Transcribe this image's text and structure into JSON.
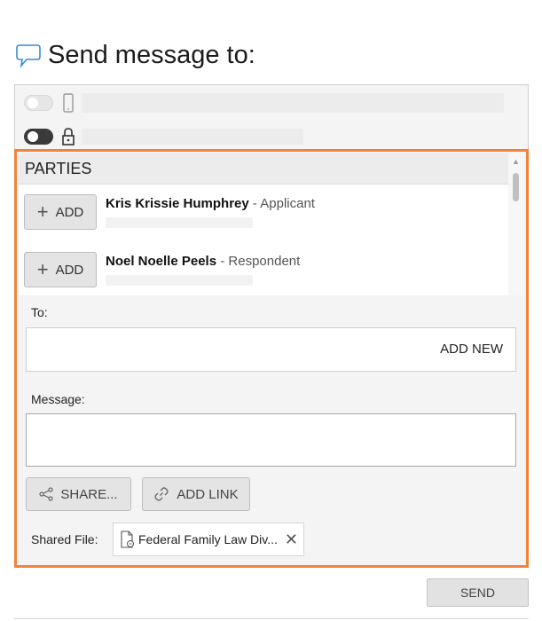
{
  "header": {
    "title": "Send message to:",
    "icon": "chat-bubble-icon"
  },
  "toggles": [
    {
      "state": "off",
      "icon": "mobile-phone-icon"
    },
    {
      "state": "on",
      "icon": "lock-icon"
    }
  ],
  "parties": {
    "header": "PARTIES",
    "items": [
      {
        "add_label": "ADD",
        "name": "Kris Krissie Humphrey",
        "separator": " - ",
        "role": "Applicant"
      },
      {
        "add_label": "ADD",
        "name": "Noel Noelle Peels",
        "separator": " - ",
        "role": "Respondent"
      }
    ]
  },
  "to": {
    "label": "To:",
    "add_new": "ADD NEW"
  },
  "message": {
    "label": "Message:",
    "value": ""
  },
  "actions": {
    "share": "SHARE...",
    "add_link": "ADD LINK"
  },
  "shared_file": {
    "label": "Shared File:",
    "name": "Federal Family Law Div..."
  },
  "send_label": "SEND",
  "colors": {
    "highlight": "#f0843a",
    "panel_bg": "#f4f4f4",
    "button_bg": "#e4e4e4"
  }
}
